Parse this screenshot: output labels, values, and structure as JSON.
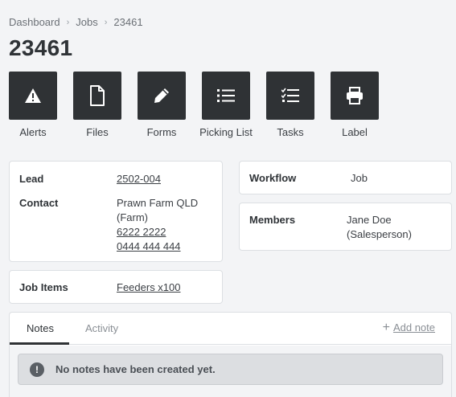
{
  "breadcrumb": {
    "items": [
      "Dashboard",
      "Jobs",
      "23461"
    ]
  },
  "page": {
    "title": "23461"
  },
  "actions": [
    {
      "label": "Alerts",
      "icon": "alert-triangle-icon"
    },
    {
      "label": "Files",
      "icon": "file-icon"
    },
    {
      "label": "Forms",
      "icon": "pencil-icon"
    },
    {
      "label": "Picking List",
      "icon": "list-icon"
    },
    {
      "label": "Tasks",
      "icon": "checklist-icon"
    },
    {
      "label": "Label",
      "icon": "printer-icon"
    }
  ],
  "details": {
    "lead": {
      "key": "Lead",
      "value": "2502-004"
    },
    "contact": {
      "key": "Contact",
      "name": "Prawn Farm QLD",
      "type": "(Farm)",
      "phone": "6222 2222",
      "mobile": "0444 444 444"
    },
    "job_items": {
      "key": "Job Items",
      "value": "Feeders x100"
    }
  },
  "workflow": {
    "key": "Workflow",
    "value": "Job"
  },
  "members": {
    "key": "Members",
    "name": "Jane Doe",
    "role": "(Salesperson)"
  },
  "tabs": {
    "items": [
      "Notes",
      "Activity"
    ],
    "active": "Notes",
    "add_note": "Add note",
    "empty_message": "No notes have been created yet."
  }
}
